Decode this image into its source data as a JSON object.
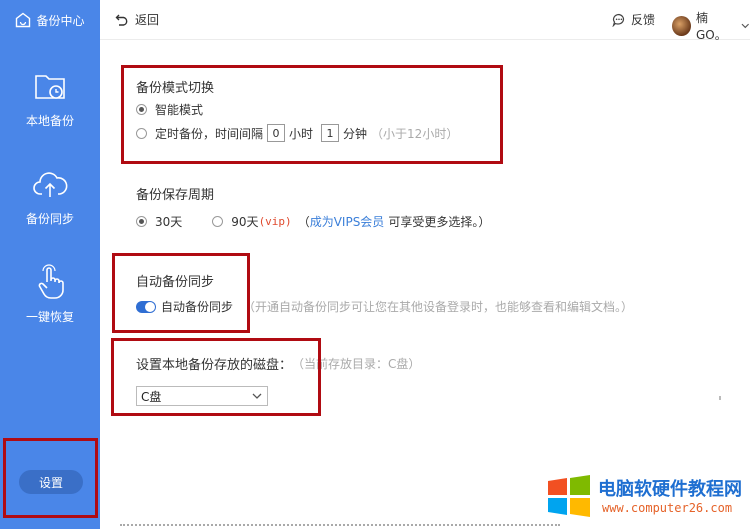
{
  "sidebar": {
    "brand": "备份中心",
    "items": [
      {
        "label": "本地备份",
        "icon": "folder-clock-icon"
      },
      {
        "label": "备份同步",
        "icon": "cloud-upload-icon"
      },
      {
        "label": "一键恢复",
        "icon": "hand-pointer-icon"
      }
    ],
    "settings_label": "设置"
  },
  "topbar": {
    "back_label": "返回",
    "feedback_label": "反馈",
    "user_name": "楠GO。"
  },
  "backup_mode": {
    "title": "备份模式切换",
    "smart_label": "智能模式",
    "timed_prefix": "定时备份，时间间隔",
    "hours_value": "0",
    "hours_unit": "小时",
    "minutes_value": "1",
    "minutes_unit": "分钟",
    "timed_hint": "（小于12小时）",
    "selected": "smart"
  },
  "retention": {
    "title": "备份保存周期",
    "opt1_label": "30天",
    "opt2_label": "90天",
    "vip_tag": "(vip)",
    "hint_open": "（",
    "link_text": "成为VIPS会员",
    "hint_rest": "可享受更多选择。）",
    "selected": "30"
  },
  "auto_sync": {
    "title": "自动备份同步",
    "toggle_label": "自动备份同步",
    "enabled": true,
    "hint": "（开通自动备份同步可让您在其他设备登录时，也能够查看和编辑文档。）"
  },
  "disk": {
    "title": "设置本地备份存放的磁盘：",
    "hint": "（当前存放目录：C盘）",
    "selected": "C盘"
  },
  "watermark": {
    "title": "电脑软硬件教程网",
    "url": "www.computer26.com"
  },
  "colors": {
    "sidebar": "#4a86e8",
    "highlight_box": "#b00b12",
    "link": "#3b7fd9",
    "toggle_on": "#2f6ed3"
  }
}
